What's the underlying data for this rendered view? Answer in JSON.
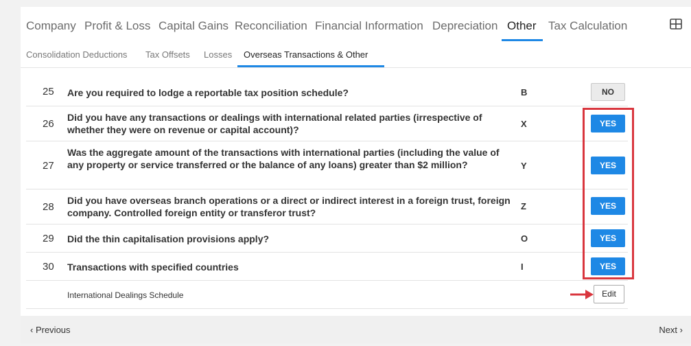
{
  "tabs": [
    "Company",
    "Profit & Loss",
    "Capital Gains",
    "Reconciliation",
    "Financial Information",
    "Depreciation",
    "Other",
    "Tax Calculation"
  ],
  "active_tab": "Other",
  "subtabs": [
    "Consolidation Deductions",
    "Tax Offsets",
    "Losses",
    "Overseas Transactions & Other"
  ],
  "active_subtab": "Overseas Transactions & Other",
  "questions": [
    {
      "num": "25",
      "text": "Are you required to lodge a reportable tax position schedule?",
      "code": "B",
      "answer": "NO"
    },
    {
      "num": "26",
      "text": "Did you have any transactions or dealings with international related parties (irrespective of whether they were on revenue or capital account)?",
      "code": "X",
      "answer": "YES"
    },
    {
      "num": "27",
      "text": "Was the aggregate amount of the transactions with international parties (including the value of any property or service transferred or the balance of any loans) greater than $2 million?",
      "code": "Y",
      "answer": "YES"
    },
    {
      "num": "28",
      "text": "Did you have overseas branch operations or a direct or indirect interest in a foreign trust, foreign company. Controlled foreign entity or transferor trust?",
      "code": "Z",
      "answer": "YES"
    },
    {
      "num": "29",
      "text": "Did the thin capitalisation provisions apply?",
      "code": "O",
      "answer": "YES"
    },
    {
      "num": "30",
      "text": "Transactions with specified countries",
      "code": "I",
      "answer": "YES"
    }
  ],
  "schedule": {
    "label": "International Dealings Schedule",
    "edit_label": "Edit"
  },
  "footer": {
    "previous": "Previous",
    "next": "Next"
  },
  "colors": {
    "accent": "#1e88e5",
    "highlight": "#d9363e"
  }
}
